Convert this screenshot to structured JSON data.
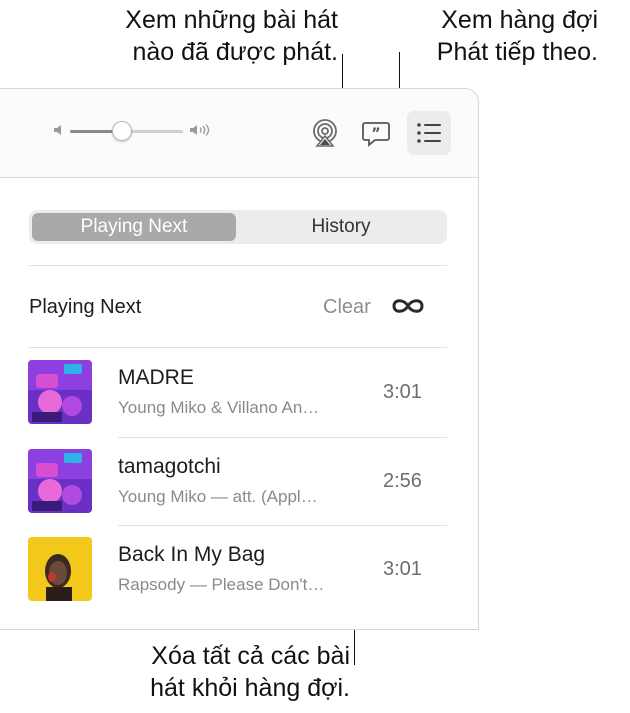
{
  "callouts": {
    "history": [
      "Xem những bài hát",
      "nào đã được phát."
    ],
    "queue": [
      "Xem hàng đợi",
      "Phát tiếp theo."
    ],
    "clear": [
      "Xóa tất cả các bài",
      "hát khỏi hàng đợi."
    ]
  },
  "toolbar": {
    "volume_low_icon": "speaker-low-icon",
    "volume_high_icon": "speaker-high-icon",
    "volume_level": 0.45,
    "airplay_icon": "airplay-icon",
    "lyrics_icon": "lyrics-quote-icon",
    "queue_icon": "list-icon",
    "queue_active": true
  },
  "segmented": {
    "options": [
      "Playing Next",
      "History"
    ],
    "selected": "Playing Next"
  },
  "queue": {
    "section_title": "Playing Next",
    "clear_label": "Clear",
    "autoplay_icon": "infinity-icon",
    "items": [
      {
        "title": "MADRE",
        "subtitle": "Young Miko & Villano An…",
        "duration": "3:01"
      },
      {
        "title": "tamagotchi",
        "subtitle": "Young Miko — att. (Appl…",
        "duration": "2:56"
      },
      {
        "title": "Back In My Bag",
        "subtitle": "Rapsody — Please Don't…",
        "duration": "3:01"
      }
    ]
  },
  "colors": {
    "segment_selected": "#a9a9a9",
    "accent_art_purple": "#7a3fd6",
    "accent_art_yellow": "#f2c81a"
  }
}
